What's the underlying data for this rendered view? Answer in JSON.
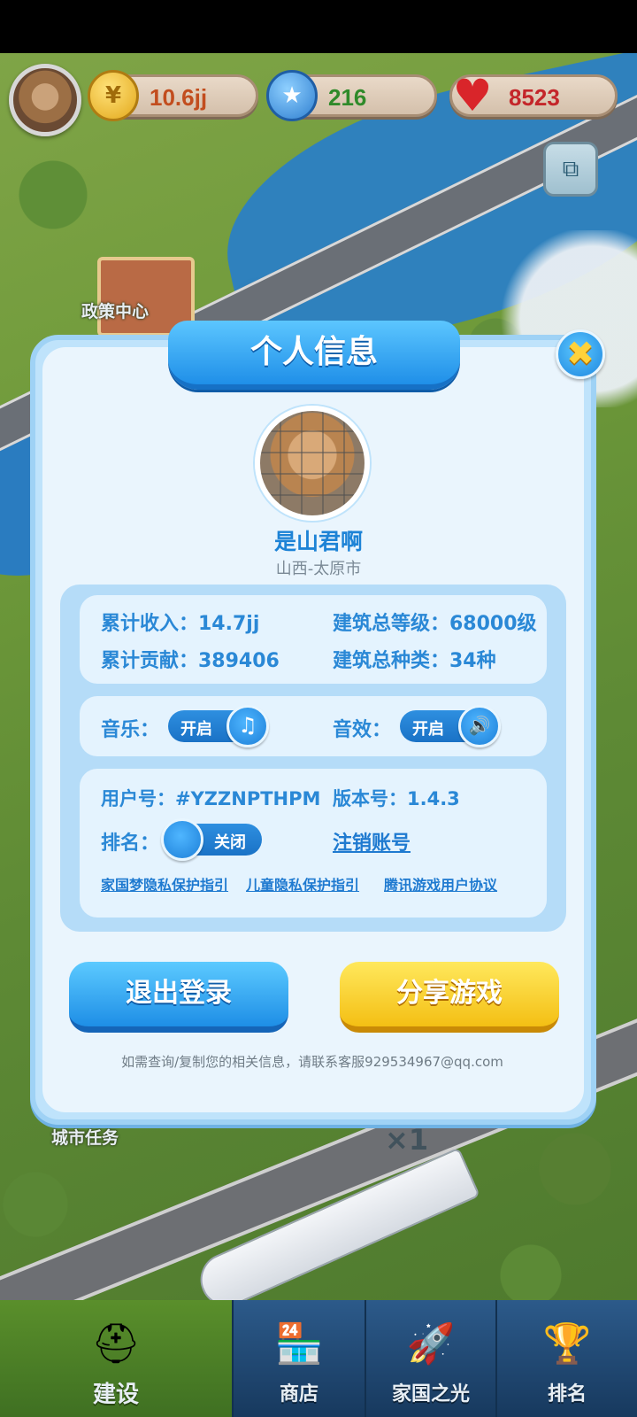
{
  "hud": {
    "coins": "10.6jj",
    "stars": "216",
    "hearts": "8523",
    "icons": [
      "coin-icon",
      "star-icon",
      "heart-icon",
      "share-icon"
    ]
  },
  "map_labels": {
    "policy_center": "政策中心",
    "city_task": "城市任务",
    "multiplier": "×1"
  },
  "dialog": {
    "title": "个人信息",
    "close_icon": "✖",
    "nickname": "是山君啊",
    "region": "山西-太原市",
    "stats": {
      "total_income": "累计收入：14.7jj",
      "building_level": "建筑总等级：68000级",
      "total_contribution": "累计贡献：389406",
      "building_types": "建筑总种类：34种"
    },
    "settings": {
      "music_label": "音乐：",
      "music_state": "开启",
      "music_icon": "♫",
      "sound_label": "音效：",
      "sound_state": "开启",
      "sound_icon": "🔊"
    },
    "account": {
      "user_id": "用户号：#YZZNPTHPM",
      "version": "版本号：1.4.3",
      "rank_label": "排名：",
      "rank_state": "关闭",
      "delete_account": "注销账号",
      "link_privacy": "家国梦隐私保护指引",
      "link_child_privacy": "儿童隐私保护指引",
      "link_agreement": "腾讯游戏用户协议"
    },
    "logout_button": "退出登录",
    "share_button": "分享游戏",
    "contact_hint": "如需查询/复制您的相关信息，请联系客服929534967@qq.com"
  },
  "bottom_nav": {
    "build": "建设",
    "shop": "商店",
    "glory": "家国之光",
    "rank": "排名"
  },
  "colors": {
    "accent_blue": "#1f8fe8",
    "accent_yellow": "#f4bf14",
    "text_blue": "#2a88d6"
  }
}
